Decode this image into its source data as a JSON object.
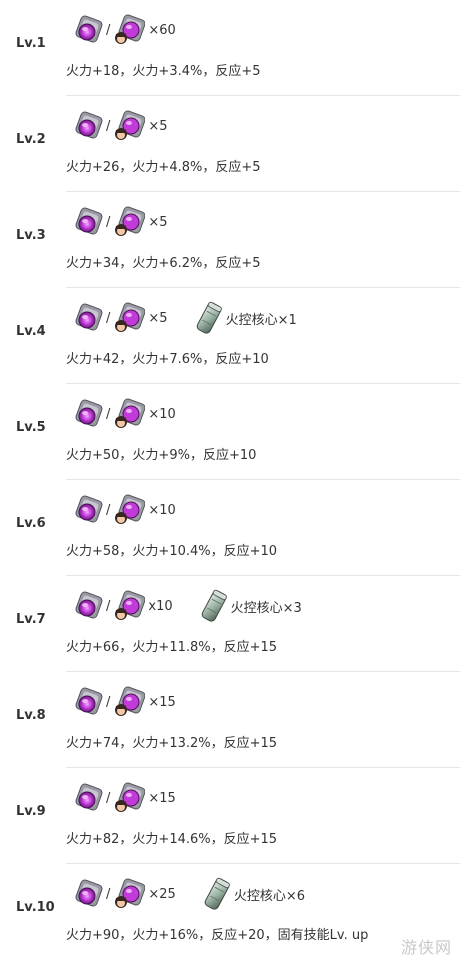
{
  "rows": [
    {
      "level": "Lv.1",
      "separator": "/",
      "count": "×60",
      "core": "",
      "effect": "火力+18，火力+3.4%，反应+5"
    },
    {
      "level": "Lv.2",
      "separator": "/",
      "count": "×5",
      "core": "",
      "effect": "火力+26，火力+4.8%，反应+5"
    },
    {
      "level": "Lv.3",
      "separator": "/",
      "count": "×5",
      "core": "",
      "effect": "火力+34，火力+6.2%，反应+5"
    },
    {
      "level": "Lv.4",
      "separator": "/",
      "count": "×5",
      "core": "火控核心×1",
      "effect": "火力+42，火力+7.6%，反应+10"
    },
    {
      "level": "Lv.5",
      "separator": "/",
      "count": "×10",
      "core": "",
      "effect": "火力+50，火力+9%，反应+10"
    },
    {
      "level": "Lv.6",
      "separator": "/",
      "count": "×10",
      "core": "",
      "effect": "火力+58，火力+10.4%，反应+10"
    },
    {
      "level": "Lv.7",
      "separator": "/",
      "count": "x10",
      "core": "火控核心×3",
      "effect": "火力+66，火力+11.8%，反应+15"
    },
    {
      "level": "Lv.8",
      "separator": "/",
      "count": "×15",
      "core": "",
      "effect": "火力+74，火力+13.2%，反应+15"
    },
    {
      "level": "Lv.9",
      "separator": "/",
      "count": "×15",
      "core": "",
      "effect": "火力+82，火力+14.6%，反应+15"
    },
    {
      "level": "Lv.10",
      "separator": "/",
      "count": "×25",
      "core": "火控核心×6",
      "effect": "火力+90，火力+16%，反应+20，固有技能Lv. up"
    }
  ],
  "watermark": "游侠网",
  "icons": {
    "chip": "purple-chip-icon",
    "chip_with_doll": "purple-chip-with-doll-icon",
    "core": "fire-control-core-icon"
  },
  "colors": {
    "chip_purple": "#c23ad8",
    "chip_gray": "#8a8a93",
    "core_green": "#9fb7a8"
  }
}
